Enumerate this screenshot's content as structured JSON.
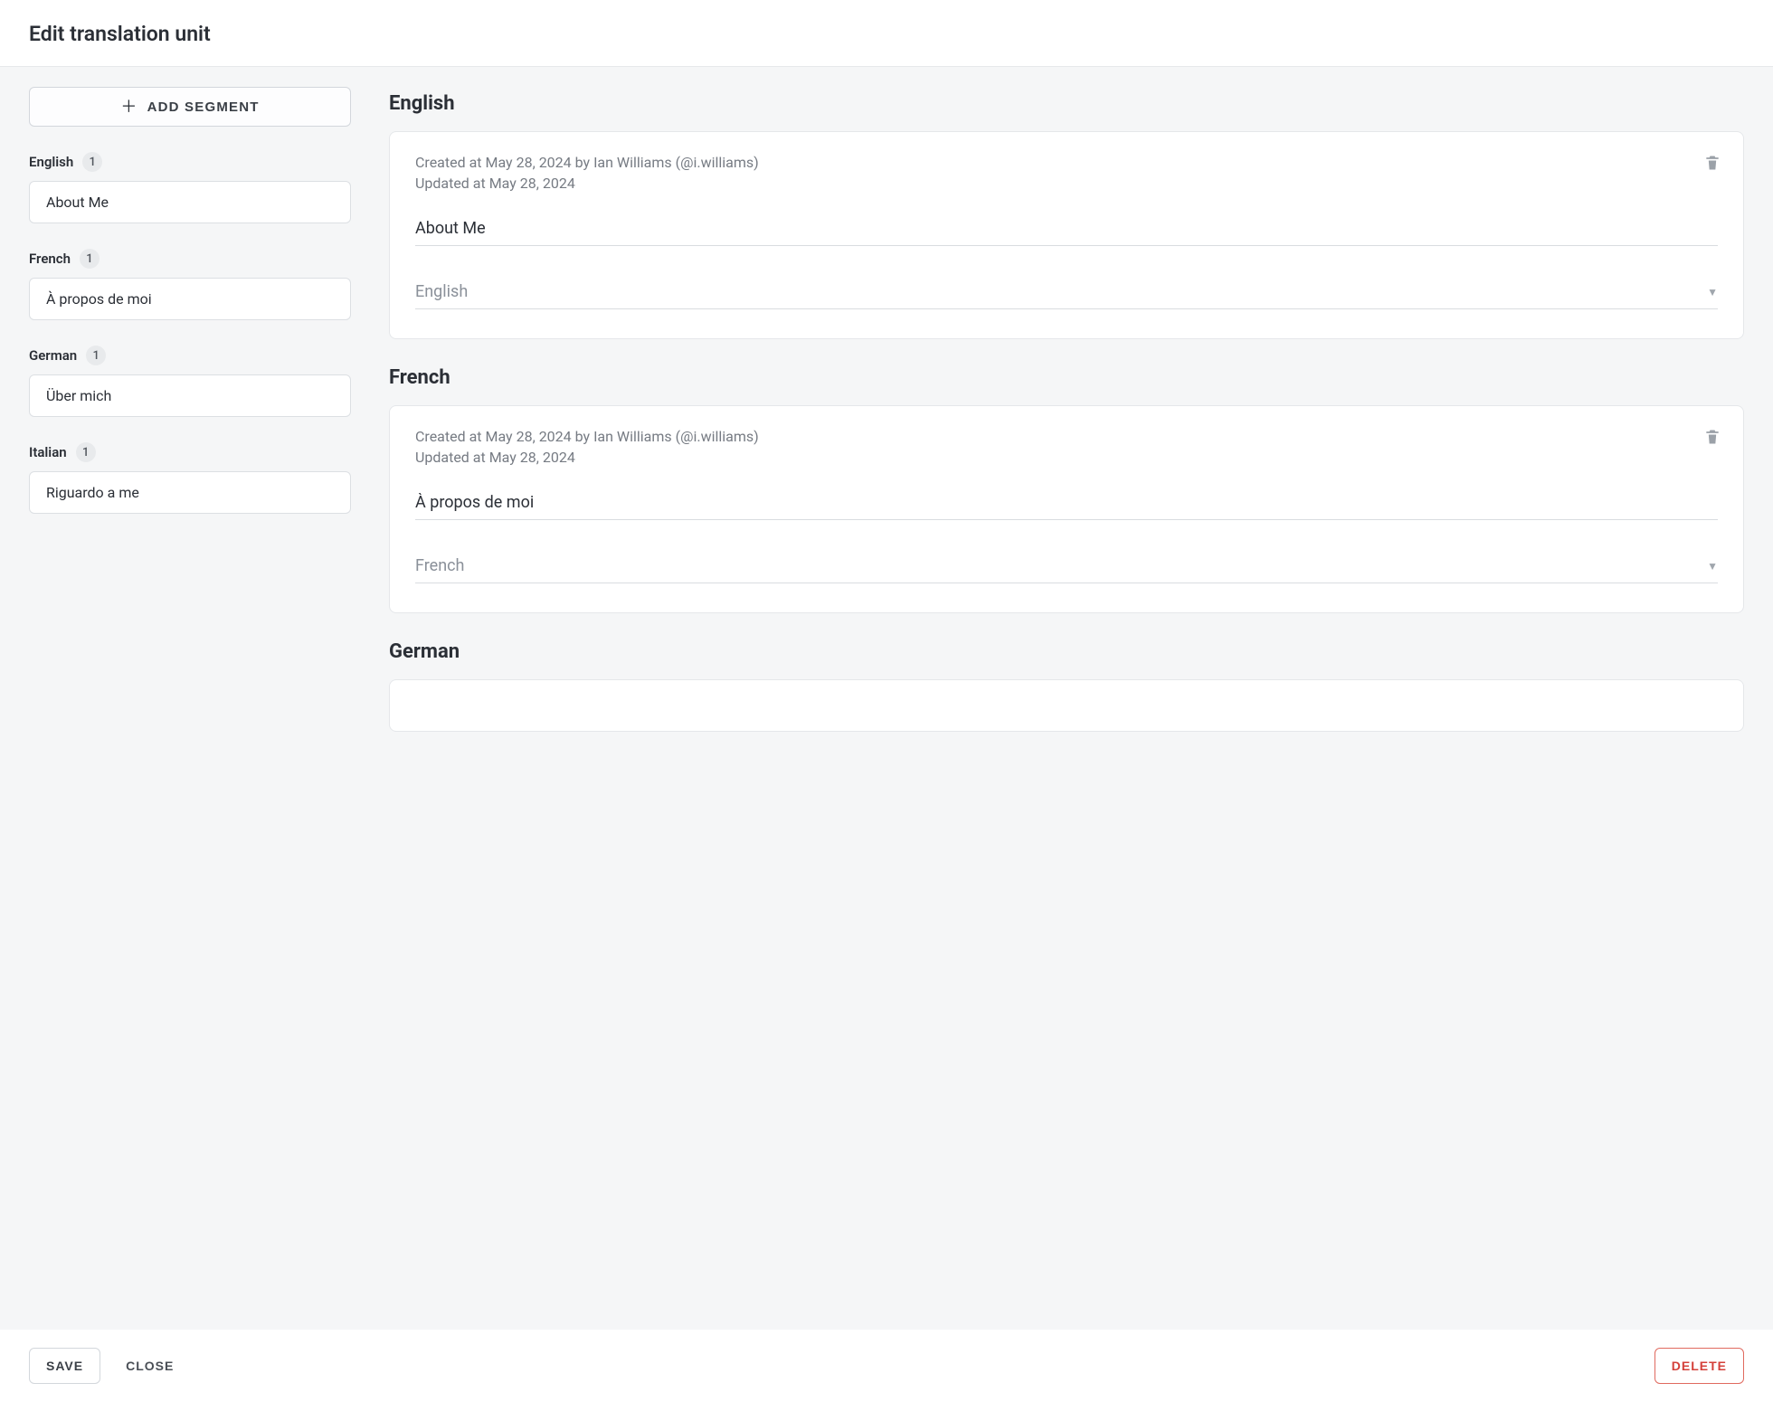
{
  "header": {
    "title": "Edit translation unit"
  },
  "sidebar": {
    "add_segment_label": "ADD SEGMENT",
    "groups": [
      {
        "language": "English",
        "count": "1",
        "segment": "About Me"
      },
      {
        "language": "French",
        "count": "1",
        "segment": "À propos de moi"
      },
      {
        "language": "German",
        "count": "1",
        "segment": "Über mich"
      },
      {
        "language": "Italian",
        "count": "1",
        "segment": "Riguardo a me"
      }
    ]
  },
  "main": {
    "sections": [
      {
        "title": "English",
        "created": "Created at May 28, 2024 by Ian Williams (@i.williams)",
        "updated": "Updated at May 28, 2024",
        "value": "About Me",
        "select": "English"
      },
      {
        "title": "French",
        "created": "Created at May 28, 2024 by Ian Williams (@i.williams)",
        "updated": "Updated at May 28, 2024",
        "value": "À propos de moi",
        "select": "French"
      },
      {
        "title": "German",
        "created": "",
        "updated": "",
        "value": "",
        "select": ""
      }
    ]
  },
  "footer": {
    "save": "SAVE",
    "close": "CLOSE",
    "delete": "DELETE"
  }
}
